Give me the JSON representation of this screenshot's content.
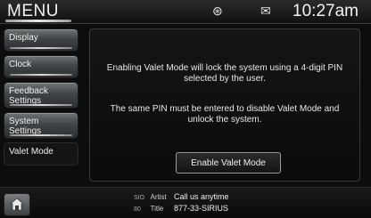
{
  "header": {
    "title": "MENU",
    "status_icon_1": "signal-icon",
    "status_icon_2": "status-icon",
    "status_icon_1_glyph": "⊛",
    "status_icon_2_glyph": "✉",
    "clock": "10:27am"
  },
  "sidebar": {
    "items": [
      {
        "label": "Display"
      },
      {
        "label": "Clock"
      },
      {
        "label": "Feedback Settings"
      },
      {
        "label": "System Settings"
      },
      {
        "label": "Valet Mode"
      }
    ]
  },
  "main": {
    "para1": "Enabling Valet Mode will lock the system using a 4-digit PIN selected by the user.",
    "para2": "The same PIN must be entered to disable Valet Mode and unlock the system.",
    "button_label": "Enable Valet Mode"
  },
  "footer": {
    "row1": {
      "key": "SIO",
      "label": "Artist",
      "value": "Call us anytime"
    },
    "row2": {
      "key": "80",
      "label": "Title",
      "value": "877-33-SIRIUS"
    }
  },
  "colors": {
    "background": "#0d0d0d",
    "button_face": "#4a4f52",
    "text": "#f0f0f0"
  }
}
